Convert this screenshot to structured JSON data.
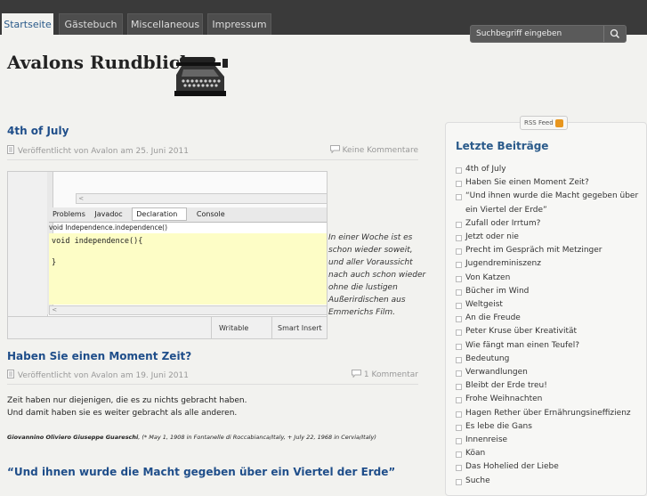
{
  "nav": {
    "tabs": [
      "Startseite",
      "Gästebuch",
      "Miscellaneous",
      "Impressum"
    ],
    "active": 0
  },
  "search": {
    "placeholder": "Suchbegriff eingeben"
  },
  "site": {
    "title": "Avalons Rundblick"
  },
  "posts": [
    {
      "title": "4th of July",
      "meta": "Veröffentlicht von Avalon am 25. Juni 2011",
      "comments": "Keine Kommentare",
      "caption": "In einer Woche ist es schon wieder soweit, und aller Voraussicht nach auch schon wieder ohne die lustigen Außerirdischen aus Emmerichs Film.",
      "ide": {
        "tabs": [
          "Problems",
          "Javadoc",
          "Declaration",
          "Console"
        ],
        "sig": "void Independence.independence()",
        "code1": "void independence(){",
        "code2": "}",
        "status1": "Writable",
        "status2": "Smart Insert"
      }
    },
    {
      "title": "Haben Sie einen Moment Zeit?",
      "meta": "Veröffentlicht von Avalon am 19. Juni 2011",
      "comments": "1 Kommentar",
      "line1": "Zeit haben nur diejenigen, die es zu nichts gebracht haben.",
      "line2": "Und damit haben sie es weiter gebracht als alle anderen.",
      "quote_author": "Giovannino Oliviero Giuseppe Guareschi",
      "quote_rest": ", (* May 1, 1908 in Fontanelle di Roccabianca/Italy, + July 22, 1968 in Cervia/Italy)"
    },
    {
      "title": "“Und ihnen wurde die Macht gegeben über ein Viertel der Erde”"
    }
  ],
  "sidebar": {
    "rss": "RSS Feed",
    "title": "Letzte Beiträge",
    "items": [
      "4th of July",
      "Haben Sie einen Moment Zeit?",
      "“Und ihnen wurde die Macht gegeben über ein Viertel der Erde”",
      "Zufall oder Irrtum?",
      "Jetzt oder nie",
      "Precht im Gespräch mit Metzinger",
      "Jugendreminiszenz",
      "Von Katzen",
      "Bücher im Wind",
      "Weltgeist",
      "An die Freude",
      "Peter Kruse über Kreativität",
      "Wie fängt man einen Teufel?",
      "Bedeutung",
      "Verwandlungen",
      "Bleibt der Erde treu!",
      "Frohe Weihnachten",
      "Hagen Rether über Ernährungsineffizienz",
      "Es lebe die Gans",
      "Innenreise",
      "Köan",
      "Das Hohelied der Liebe",
      "Suche"
    ]
  }
}
